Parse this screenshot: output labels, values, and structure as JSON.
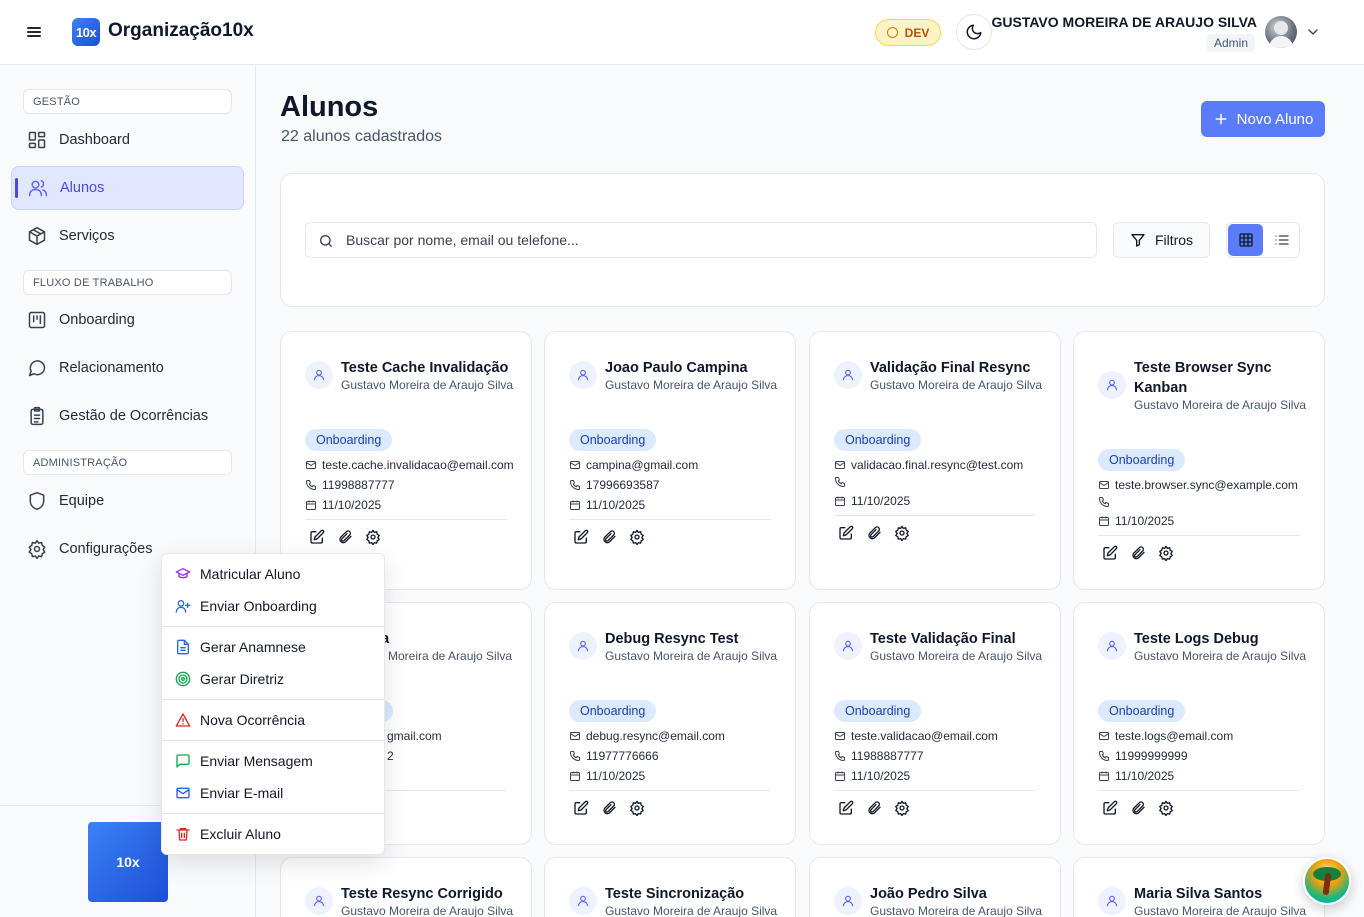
{
  "header": {
    "org_logo": "10x",
    "org_name": "Organização10x",
    "env_badge": "DEV",
    "user_name": "GUSTAVO MOREIRA DE ARAUJO SILVA",
    "user_role": "Admin"
  },
  "sidebar": {
    "sections": [
      {
        "label": "GESTÃO"
      },
      {
        "label": "FLUXO DE TRABALHO"
      },
      {
        "label": "ADMINISTRAÇÃO"
      }
    ],
    "items": [
      {
        "label": "Dashboard",
        "icon": "dashboard-icon"
      },
      {
        "label": "Alunos",
        "icon": "users-icon",
        "active": true
      },
      {
        "label": "Serviços",
        "icon": "package-icon"
      },
      {
        "label": "Onboarding",
        "icon": "kanban-icon"
      },
      {
        "label": "Relacionamento",
        "icon": "chat-icon"
      },
      {
        "label": "Gestão de Ocorrências",
        "icon": "clipboard-icon"
      },
      {
        "label": "Equipe",
        "icon": "shield-icon"
      },
      {
        "label": "Configurações",
        "icon": "gear-icon"
      }
    ],
    "footer_logo": "10x"
  },
  "main": {
    "title": "Alunos",
    "subtitle": "22 alunos cadastrados",
    "new_button": "Novo Aluno",
    "search_placeholder": "Buscar por nome, email ou telefone...",
    "filters_label": "Filtros",
    "view_mode": "grid"
  },
  "students": [
    {
      "name": "Teste Cache Invalidação",
      "owner": "Gustavo Moreira de Araujo Silva",
      "status": "Onboarding",
      "email": "teste.cache.invalidacao@email.com",
      "phone": "11998887777",
      "date": "11/10/2025"
    },
    {
      "name": "Joao Paulo Campina",
      "owner": "Gustavo Moreira de Araujo Silva",
      "status": "Onboarding",
      "email": "campina@gmail.com",
      "phone": "17996693587",
      "date": "11/10/2025"
    },
    {
      "name": "Validação Final Resync",
      "owner": "Gustavo Moreira de Araujo Silva",
      "status": "Onboarding",
      "email": "validacao.final.resync@test.com",
      "phone": "",
      "date": "11/10/2025"
    },
    {
      "name": "Teste Browser Sync Kanban",
      "owner": "Gustavo Moreira de Araujo Silva",
      "status": "Onboarding",
      "email": "teste.browser.sync@example.com",
      "phone": "",
      "date": "11/10/2025"
    },
    {
      "name": "lva",
      "owner": "Moreira de Araujo Silva",
      "status": "",
      "email": "gmail.com",
      "phone": "2",
      "date": ""
    },
    {
      "name": "Debug Resync Test",
      "owner": "Gustavo Moreira de Araujo Silva",
      "status": "Onboarding",
      "email": "debug.resync@email.com",
      "phone": "11977776666",
      "date": "11/10/2025"
    },
    {
      "name": "Teste Validação Final",
      "owner": "Gustavo Moreira de Araujo Silva",
      "status": "Onboarding",
      "email": "teste.validacao@email.com",
      "phone": "11988887777",
      "date": "11/10/2025"
    },
    {
      "name": "Teste Logs Debug",
      "owner": "Gustavo Moreira de Araujo Silva",
      "status": "Onboarding",
      "email": "teste.logs@email.com",
      "phone": "11999999999",
      "date": "11/10/2025"
    },
    {
      "name": "Teste Resync Corrigido",
      "owner": "Gustavo Moreira de Araujo Silva"
    },
    {
      "name": "Teste Sincronização",
      "owner": "Gustavo Moreira de Araujo Silva"
    },
    {
      "name": "João Pedro Silva",
      "owner": "Gustavo Moreira de Araujo Silva"
    },
    {
      "name": "Maria Silva Santos",
      "owner": "Gustavo Moreira de Araujo Silva"
    }
  ],
  "context_menu": {
    "items": [
      {
        "label": "Matricular Aluno",
        "icon": "graduation-cap-icon",
        "color": "#9333ea"
      },
      {
        "label": "Enviar Onboarding",
        "icon": "user-plus-icon",
        "color": "#2563eb"
      },
      {
        "label": "Gerar Anamnese",
        "icon": "file-text-icon",
        "color": "#2563eb"
      },
      {
        "label": "Gerar Diretriz",
        "icon": "target-icon",
        "color": "#16a34a"
      },
      {
        "label": "Nova Ocorrência",
        "icon": "alert-triangle-icon",
        "color": "#dc2626"
      },
      {
        "label": "Enviar Mensagem",
        "icon": "message-icon",
        "color": "#16a34a"
      },
      {
        "label": "Enviar E-mail",
        "icon": "mail-icon",
        "color": "#2563eb"
      },
      {
        "label": "Excluir Aluno",
        "icon": "trash-icon",
        "color": "#dc2626"
      }
    ]
  },
  "colors": {
    "accent": "#5b7cfa",
    "active_nav": "#4f46e5",
    "badge_bg": "#dbeafe",
    "dev_badge": "#fef3c7"
  }
}
